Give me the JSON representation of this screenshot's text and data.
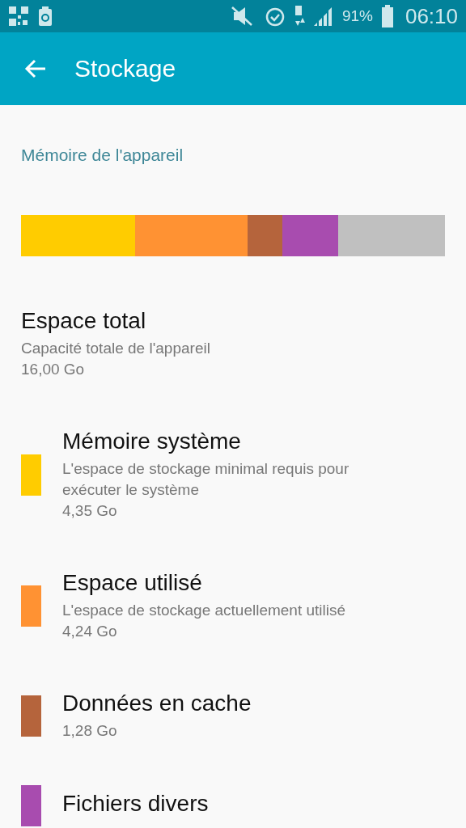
{
  "status_bar": {
    "battery": "91%",
    "time": "06:10"
  },
  "toolbar": {
    "title": "Stockage"
  },
  "section": {
    "title": "Mémoire de l'appareil"
  },
  "usage_bar": [
    {
      "color": "#ffcc00"
    },
    {
      "color": "#ff9233"
    },
    {
      "color": "#b5643c"
    },
    {
      "color": "#a84caf"
    },
    {
      "color": "#c0c0c0"
    }
  ],
  "total": {
    "title": "Espace total",
    "description": "Capacité totale de l'appareil",
    "size": "16,00 Go"
  },
  "items": [
    {
      "title": "Mémoire système",
      "description": "L'espace de stockage minimal requis pour exécuter le système",
      "size": "4,35 Go",
      "color": "#ffcc00"
    },
    {
      "title": "Espace utilisé",
      "description": "L'espace de stockage actuellement utilisé",
      "size": "4,24 Go",
      "color": "#ff9233"
    },
    {
      "title": "Données en cache",
      "size": "1,28 Go",
      "color": "#b5643c"
    },
    {
      "title": "Fichiers divers",
      "color": "#a84caf"
    }
  ]
}
